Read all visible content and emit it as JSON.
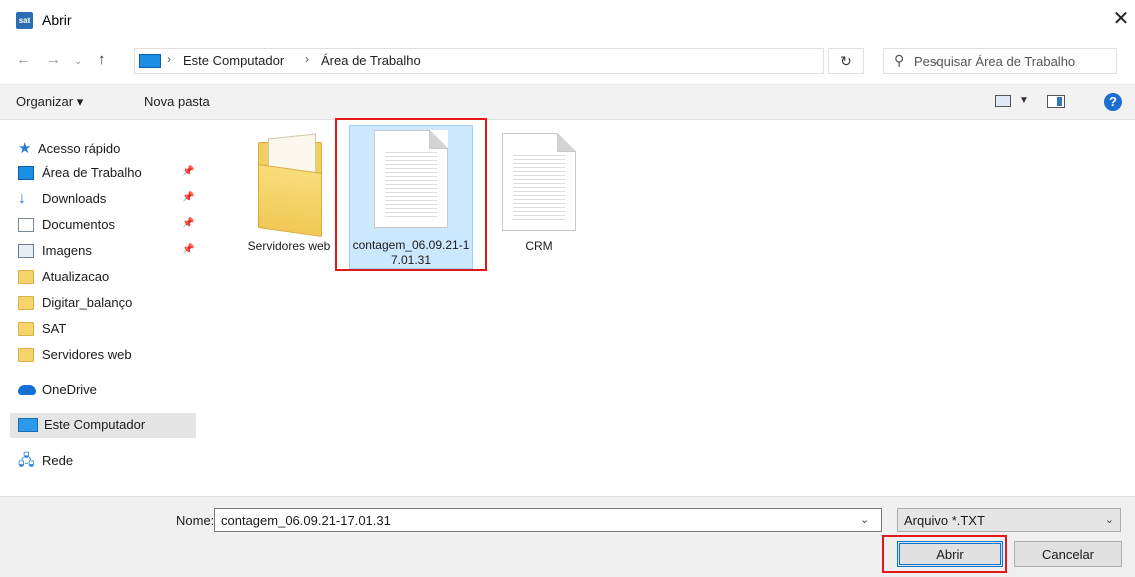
{
  "window": {
    "title": "Abrir",
    "app_icon_text": "sat"
  },
  "address": {
    "crumbs": [
      "Este Computador",
      "Área de Trabalho"
    ],
    "search_placeholder": "Pesquisar Área de Trabalho"
  },
  "toolbar": {
    "organize_label": "Organizar ▾",
    "new_folder_label": "Nova pasta"
  },
  "sidebar": {
    "items": [
      {
        "label": "Acesso rápido",
        "icon": "star-icon"
      },
      {
        "label": "Área de Trabalho",
        "icon": "desktop-icon",
        "pinned": true
      },
      {
        "label": "Downloads",
        "icon": "download-icon",
        "pinned": true
      },
      {
        "label": "Documentos",
        "icon": "documents-icon",
        "pinned": true
      },
      {
        "label": "Imagens",
        "icon": "pictures-icon",
        "pinned": true
      },
      {
        "label": "Atualizacao",
        "icon": "folder-icon"
      },
      {
        "label": "Digitar_balanço",
        "icon": "folder-icon"
      },
      {
        "label": "SAT",
        "icon": "folder-icon"
      },
      {
        "label": "Servidores web",
        "icon": "folder-icon"
      },
      {
        "label": "OneDrive",
        "icon": "cloud-icon"
      },
      {
        "label": "Este Computador",
        "icon": "computer-icon",
        "selected": true
      },
      {
        "label": "Rede",
        "icon": "network-icon"
      }
    ]
  },
  "files": [
    {
      "label": "Servidores web",
      "type": "folder"
    },
    {
      "label": "contagem_06.09.21-17.01.31",
      "type": "text-file",
      "selected": true
    },
    {
      "label": "CRM",
      "type": "text-file"
    }
  ],
  "footer": {
    "name_label": "Nome:",
    "name_value": "contagem_06.09.21-17.01.31",
    "file_type": "Arquivo *.TXT",
    "open_label": "Abrir",
    "cancel_label": "Cancelar"
  },
  "colors": {
    "selection_bg": "#cce8ff",
    "highlight_red": "#e31818",
    "accent": "#0078d7"
  }
}
